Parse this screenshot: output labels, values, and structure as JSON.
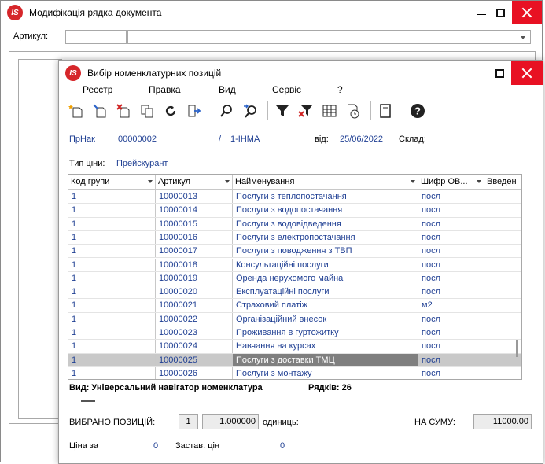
{
  "back_window": {
    "title": "Модифікація рядка документа",
    "artikul_label": "Артикул:"
  },
  "front_window": {
    "title": "Вибір номенклатурних позицій",
    "menu": [
      "Реєстр",
      "Правка",
      "Вид",
      "Сервіс",
      "?"
    ],
    "toolbar_icons": [
      "add-icon",
      "edit-icon",
      "delete-icon",
      "copy-icon",
      "refresh-icon",
      "export-icon",
      "find-icon",
      "find-next-icon",
      "filter-icon",
      "clear-filter-icon",
      "table-icon",
      "calendar-icon",
      "card-icon",
      "help-icon"
    ],
    "header": {
      "prnak": "ПрНак",
      "doc_number": "00000002",
      "slash": "/",
      "code": "1-ІНМА",
      "vid_label": "від:",
      "date": "25/06/2022",
      "sklad_label": "Склад:",
      "price_type_label": "Тип ціни:",
      "price_type": "Прейскурант"
    },
    "table": {
      "columns": [
        "Код групи",
        "Артикул",
        "Найменування",
        "Шифр ОВ...",
        "Введен"
      ],
      "rows": [
        [
          "1",
          "10000013",
          "Послуги з теплопостачання",
          "посл"
        ],
        [
          "1",
          "10000014",
          "Послуги з водопостачання",
          "посл"
        ],
        [
          "1",
          "10000015",
          "Послуги з водовідведення",
          "посл"
        ],
        [
          "1",
          "10000016",
          "Послуги з електропостачання",
          "посл"
        ],
        [
          "1",
          "10000017",
          "Послуги з поводження з ТВП",
          "посл"
        ],
        [
          "1",
          "10000018",
          "Консультаційні послуги",
          "посл"
        ],
        [
          "1",
          "10000019",
          "Оренда нерухомого майна",
          "посл"
        ],
        [
          "1",
          "10000020",
          "Експлуатаційні послуги",
          "посл"
        ],
        [
          "1",
          "10000021",
          "Страховий платіж",
          "м2"
        ],
        [
          "1",
          "10000022",
          "Організаційний внесок",
          "посл"
        ],
        [
          "1",
          "10000023",
          "Проживання в гуртожитку",
          "посл"
        ],
        [
          "1",
          "10000024",
          "Навчання на курсах",
          "посл"
        ],
        [
          "1",
          "10000025",
          "Послуги з доставки ТМЦ",
          "посл"
        ],
        [
          "1",
          "10000026",
          "Послуги з монтажу",
          "посл"
        ]
      ],
      "selected_row": 12
    },
    "status": {
      "view_text": "Вид: Універсальний навігатор номенклатура",
      "rows_text": "Рядків: 26"
    },
    "selected": {
      "label": "ВИБРАНО ПОЗИЦІЙ:",
      "count": "1",
      "quantity": "1.000000",
      "units_label": "одиниць:",
      "sum_label": "НА СУМУ:",
      "sum": "11000.00"
    },
    "bottom": {
      "price_label": "Ціна за",
      "price_value": "0",
      "zastav_label": "Застав. цін",
      "zastav_value": "0"
    }
  }
}
